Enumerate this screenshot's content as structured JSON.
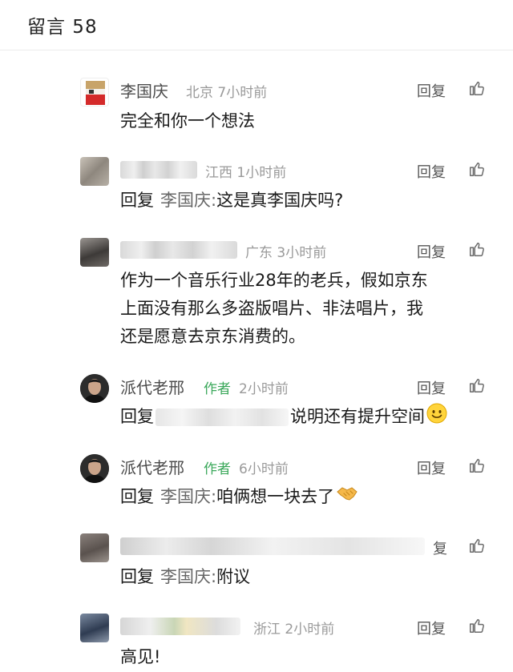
{
  "header": {
    "title": "留言 58"
  },
  "reply_label": "回复",
  "reply_label_partial": "复",
  "colors": {
    "author_tag": "#3aa85a",
    "meta": "#9a9a9a",
    "body_text": "#1a1a1a"
  },
  "comments": [
    {
      "name": "李国庆",
      "meta": "北京 7小时前",
      "text": "完全和你一个想法"
    },
    {
      "meta": "江西 1小时前",
      "reply_to": "李国庆:",
      "text": "这是真李国庆吗?"
    },
    {
      "meta": "广东 3小时前",
      "lines": [
        "作为一个音乐行业28年的老兵，假如京东",
        "上面没有那么多盗版唱片、非法唱片，我",
        "还是愿意去京东消费的。"
      ]
    },
    {
      "name": "派代老邢",
      "author_tag": "作者",
      "meta": "2小时前",
      "reply_prefix": "回复",
      "text": "说明还有提升空间",
      "emoji": "smile-emoji"
    },
    {
      "name": "派代老邢",
      "author_tag": "作者",
      "meta": "6小时前",
      "reply_to": "李国庆:",
      "text": "咱俩想一块去了",
      "emoji": "handshake-emoji"
    },
    {
      "reply_to": "李国庆:",
      "text": "附议"
    },
    {
      "meta": "浙江 2小时前",
      "text": "高见!"
    }
  ]
}
